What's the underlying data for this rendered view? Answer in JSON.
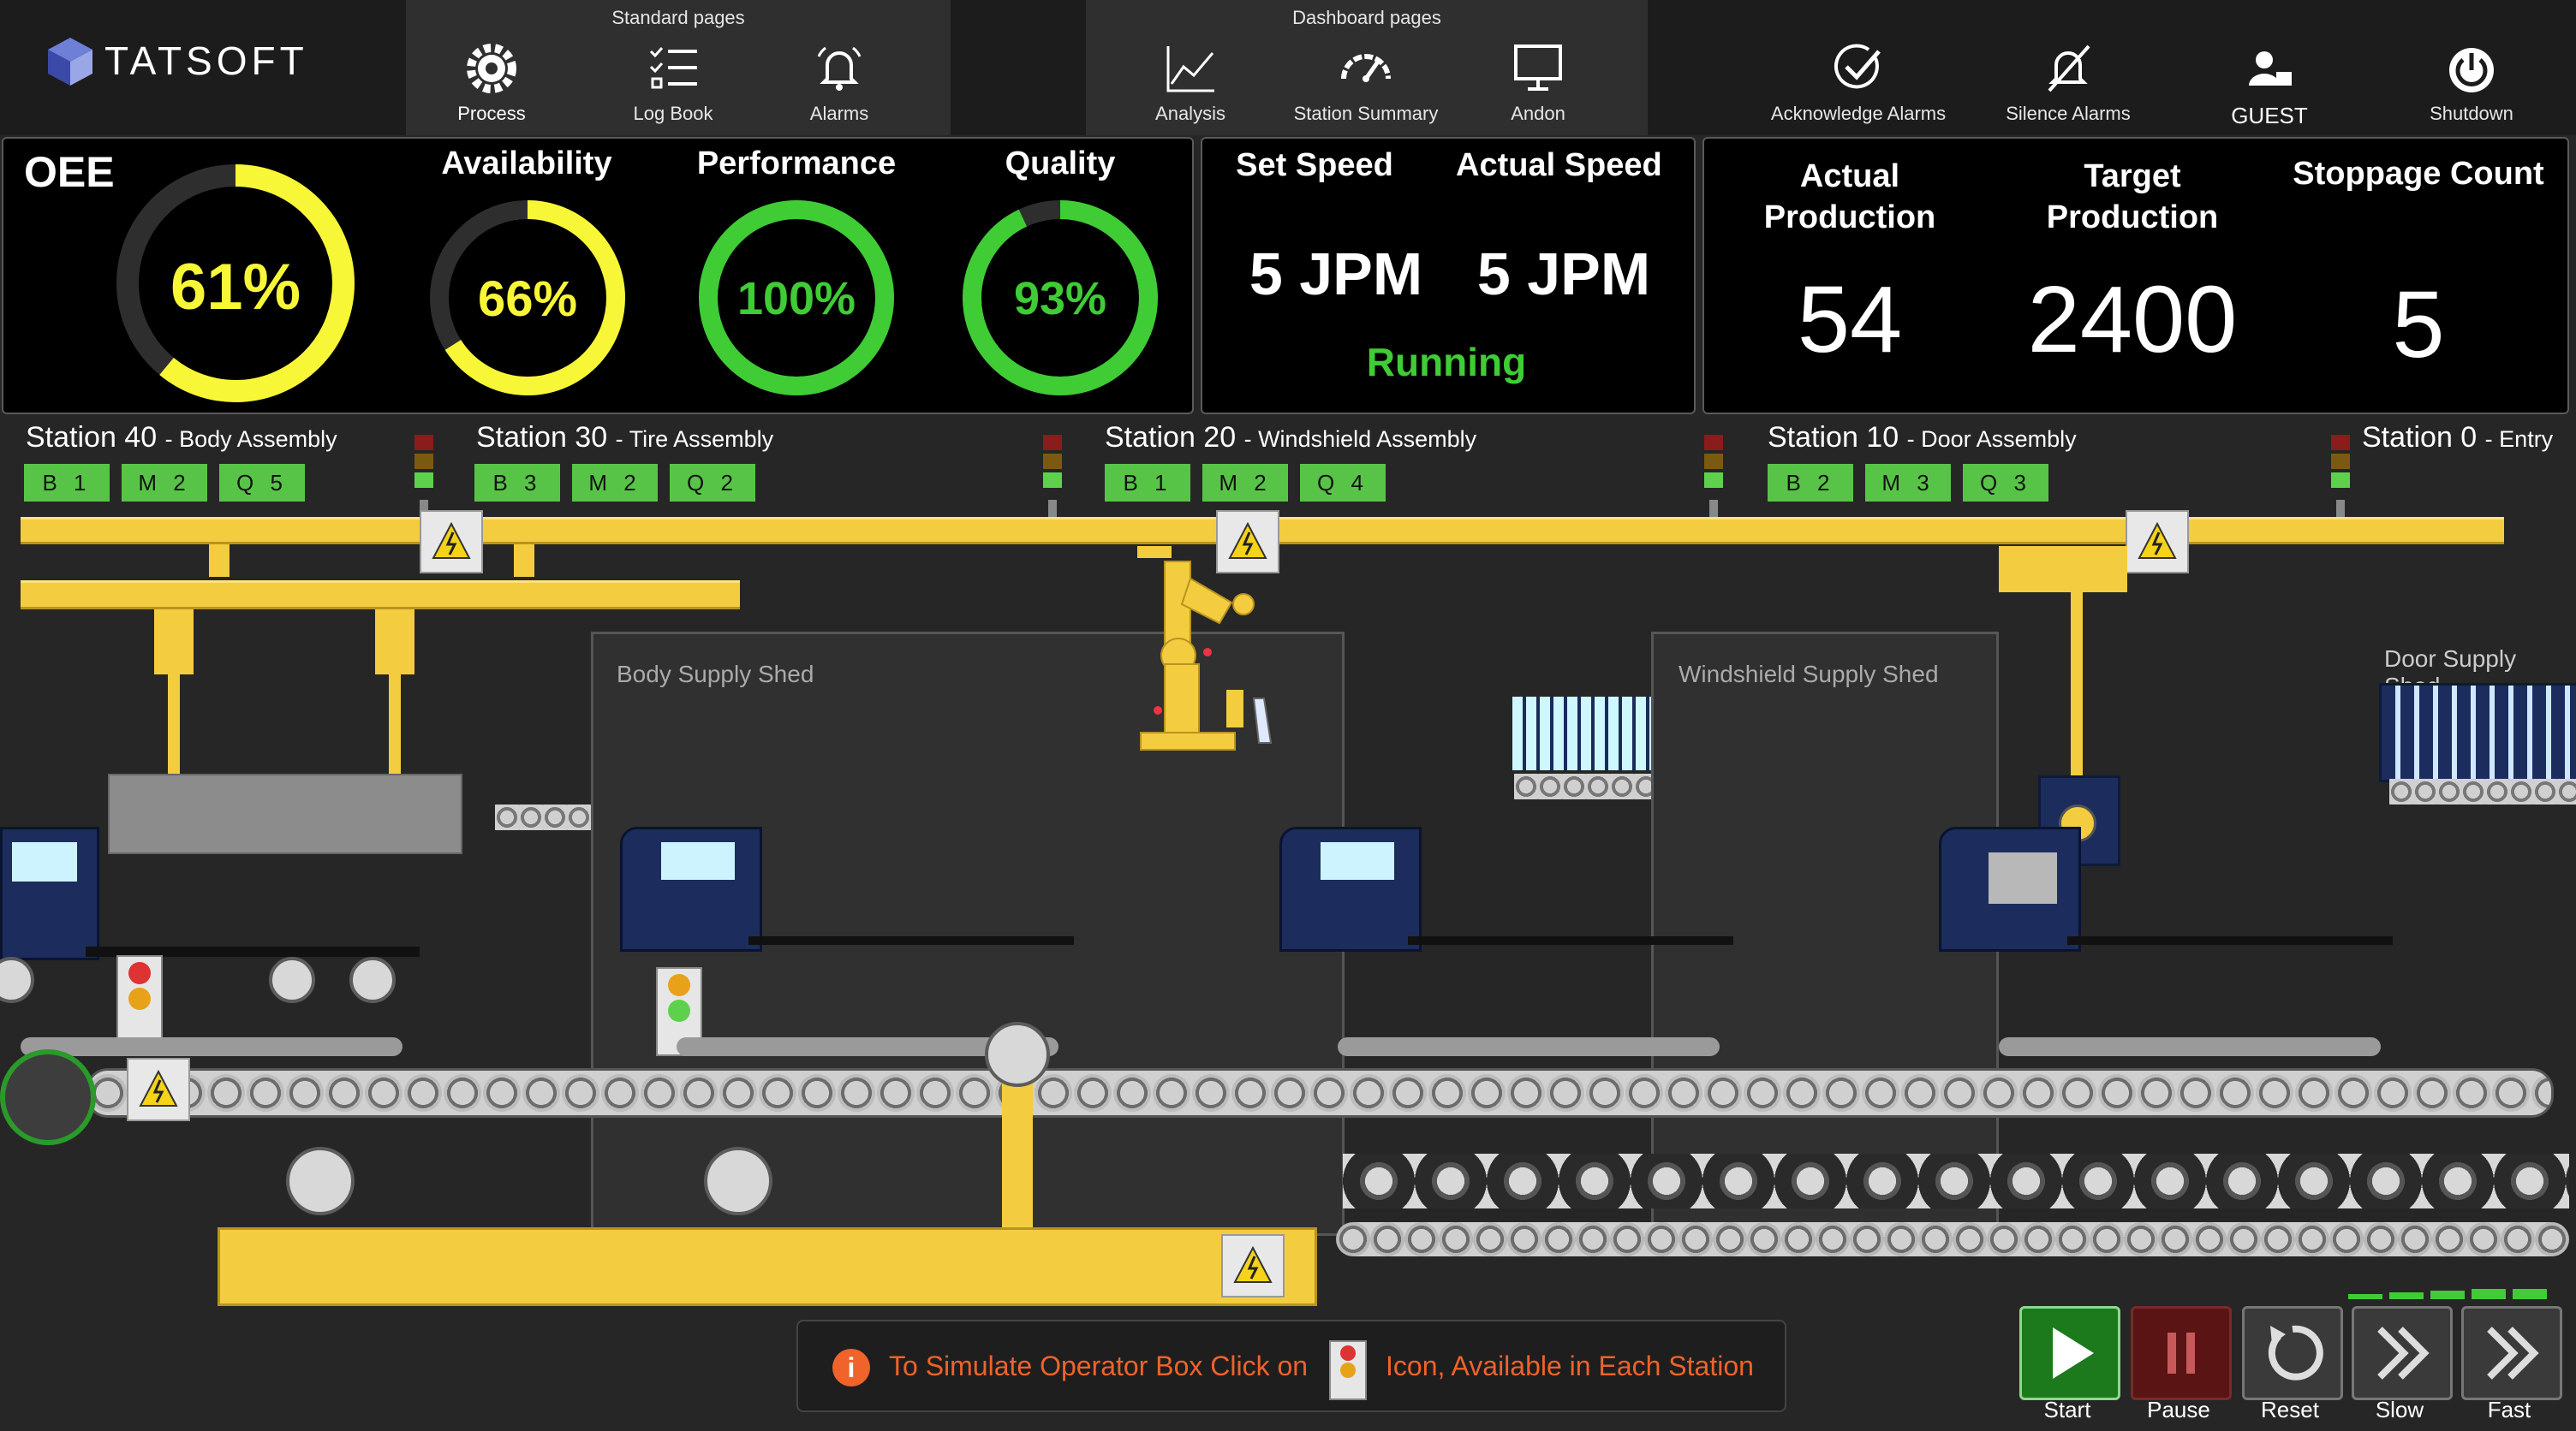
{
  "brand": "TATSOFT",
  "nav": {
    "standard_title": "Standard pages",
    "dashboard_title": "Dashboard pages",
    "standard": [
      {
        "label": "Process",
        "icon": "gear-icon"
      },
      {
        "label": "Log Book",
        "icon": "checklist-icon"
      },
      {
        "label": "Alarms",
        "icon": "alarm-bell-icon"
      }
    ],
    "dashboard": [
      {
        "label": "Analysis",
        "icon": "line-chart-icon"
      },
      {
        "label": "Station Summary",
        "icon": "speedometer-icon"
      },
      {
        "label": "Andon",
        "icon": "monitor-icon"
      }
    ],
    "actions": [
      {
        "label": "Acknowledge Alarms",
        "icon": "check-circle-icon"
      },
      {
        "label": "Silence Alarms",
        "icon": "bell-off-icon"
      },
      {
        "label": "GUEST",
        "icon": "user-icon"
      },
      {
        "label": "Shutdown",
        "icon": "power-icon"
      }
    ]
  },
  "oee": {
    "title": "OEE",
    "value": "61%",
    "fraction": 0.61,
    "availability": {
      "title": "Availability",
      "value": "66%",
      "fraction": 0.66,
      "color": "#f7f738"
    },
    "performance": {
      "title": "Performance",
      "value": "100%",
      "fraction": 1.0,
      "color": "#3fcc35"
    },
    "quality": {
      "title": "Quality",
      "value": "93%",
      "fraction": 0.93,
      "color": "#3fcc35"
    },
    "oee_color": "#f7f738"
  },
  "speed": {
    "set_title": "Set Speed",
    "set_value": "5 JPM",
    "actual_title": "Actual Speed",
    "actual_value": "5 JPM",
    "status": "Running",
    "status_color": "#3fcc35"
  },
  "production": {
    "actual_title": "Actual Production",
    "actual_value": "54",
    "target_title": "Target Production",
    "target_value": "2400",
    "stoppage_title": "Stoppage Count",
    "stoppage_value": "5"
  },
  "stations": [
    {
      "name": "Station 40",
      "desc": "- Body Assembly",
      "chips": [
        "B 1",
        "M 2",
        "Q 5"
      ]
    },
    {
      "name": "Station 30",
      "desc": "- Tire Assembly",
      "chips": [
        "B 3",
        "M 2",
        "Q 2"
      ]
    },
    {
      "name": "Station 20",
      "desc": "- Windshield Assembly",
      "chips": [
        "B 1",
        "M 2",
        "Q 4"
      ]
    },
    {
      "name": "Station 10",
      "desc": "- Door Assembly",
      "chips": [
        "B 2",
        "M 3",
        "Q 3"
      ]
    },
    {
      "name": "Station 0",
      "desc": "- Entry",
      "chips": []
    }
  ],
  "sheds": {
    "body": "Body Supply Shed",
    "windshield": "Windshield Supply Shed",
    "door": "Door Supply Shed"
  },
  "hint": {
    "left": "To Simulate Operator Box Click on",
    "right": "Icon, Available in Each Station",
    "color": "#f0632a"
  },
  "controls": [
    {
      "label": "Start",
      "icon": "play-icon"
    },
    {
      "label": "Pause",
      "icon": "pause-icon"
    },
    {
      "label": "Reset",
      "icon": "reset-icon"
    },
    {
      "label": "Slow",
      "icon": "slow-icon"
    },
    {
      "label": "Fast",
      "icon": "fast-icon"
    }
  ]
}
